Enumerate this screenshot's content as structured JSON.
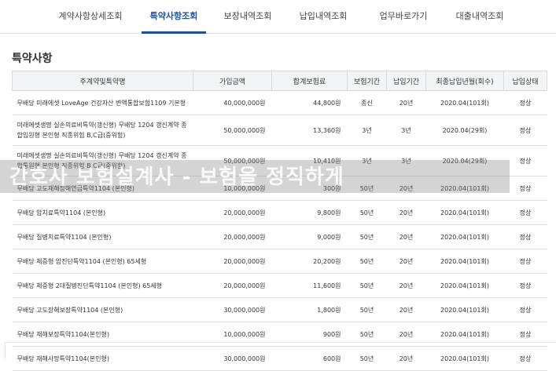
{
  "tabs": [
    {
      "label": "계약사항상세조회"
    },
    {
      "label": "특약사항조회"
    },
    {
      "label": "보장내역조회"
    },
    {
      "label": "납입내역조회"
    },
    {
      "label": "업무바로가기"
    },
    {
      "label": "대출내역조회"
    }
  ],
  "active_tab": "특약사항조회",
  "section_title": "특약사항",
  "table": {
    "headers": [
      "주계약및특약명",
      "가입금액",
      "합계보험료",
      "보험기간",
      "납입기간",
      "최종납입년월(회수)",
      "납입상태"
    ],
    "rows": [
      [
        "무배당 미래에셋 LoveAge 건강자산 변액통합보험1109 기본형",
        "40,000,000원",
        "44,800원",
        "종신",
        "20년",
        "2020.04(101회)",
        "정상"
      ],
      [
        "미래에셋생명 실손의료비특약(갱신형) 무배당 1204 갱신계약 종합입원형 본인형 직종위험 B,C급(중위험)",
        "50,000,000원",
        "13,360원",
        "3년",
        "3년",
        "2020.04(29회)",
        "정상"
      ],
      [
        "미래에셋생명 실손의료비특약(갱신형) 무배당 1204 갱신계약 종합통원형 본인형 직종위험 B,C급(중위험)",
        "50,000,000원",
        "10,410원",
        "3년",
        "3년",
        "2020.04(29회)",
        "정상"
      ],
      [
        "무배당 고도재해장해연금특약1104 (본인형)",
        "10,000,000원",
        "300원",
        "50년",
        "20년",
        "2020.04(101회)",
        "정상"
      ],
      [
        "무배당 암치료특약1104 (본인형)",
        "20,000,000원",
        "9,800원",
        "50년",
        "20년",
        "2020.04(101회)",
        "정상"
      ],
      [
        "무배당 질병치료특약1104 (본인형)",
        "20,000,000원",
        "9,000원",
        "50년",
        "20년",
        "2020.04(101회)",
        "정상"
      ],
      [
        "무배당 체증형 암진단특약1104 (본인형) 65세형",
        "20,000,000원",
        "20,200원",
        "50년",
        "20년",
        "2020.04(101회)",
        "정상"
      ],
      [
        "무배당 체증형 2대질병진단특약1104 (본인형) 65세형",
        "20,000,000원",
        "11,600원",
        "50년",
        "20년",
        "2020.04(101회)",
        "정상"
      ],
      [
        "무배당 고도장해보장특약1104 (본인형)",
        "30,000,000원",
        "1,800원",
        "50년",
        "20년",
        "2020.04(101회)",
        "정상"
      ],
      [
        "무배당 재해보장특약1104(본인형)",
        "10,000,000원",
        "900원",
        "50년",
        "20년",
        "2020.04(101회)",
        "정상"
      ],
      [
        "무배당 재해사망특약1104(본인형)",
        "30,000,000원",
        "600원",
        "50년",
        "20년",
        "2020.04(101회)",
        "정상"
      ]
    ]
  },
  "watermark": "간호사 보험설계사 - 보험을 정직하게"
}
